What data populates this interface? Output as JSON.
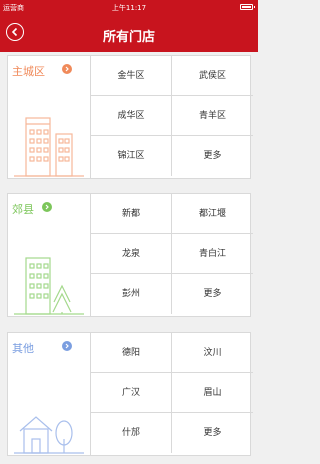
{
  "status_bar": {
    "carrier": "运营商",
    "time": "上午11:17"
  },
  "nav": {
    "title": "所有门店"
  },
  "colors": {
    "brand": "#c8141e",
    "urban": "#f08a5a",
    "suburb": "#7cc65a",
    "other": "#7b9ee0"
  },
  "sections": [
    {
      "name": "主城区",
      "arrow_icon": "chevron-right-icon",
      "illustration": "office-buildings-icon",
      "items": [
        "金牛区",
        "武侯区",
        "成华区",
        "青羊区",
        "锦江区",
        "更多"
      ]
    },
    {
      "name": "郊县",
      "arrow_icon": "chevron-right-icon",
      "illustration": "building-and-tree-icon",
      "items": [
        "新都",
        "都江堰",
        "龙泉",
        "青白江",
        "彭州",
        "更多"
      ]
    },
    {
      "name": "其他",
      "arrow_icon": "chevron-right-icon",
      "illustration": "house-and-tree-icon",
      "items": [
        "德阳",
        "汶川",
        "广汉",
        "眉山",
        "什邡",
        "更多"
      ]
    }
  ]
}
